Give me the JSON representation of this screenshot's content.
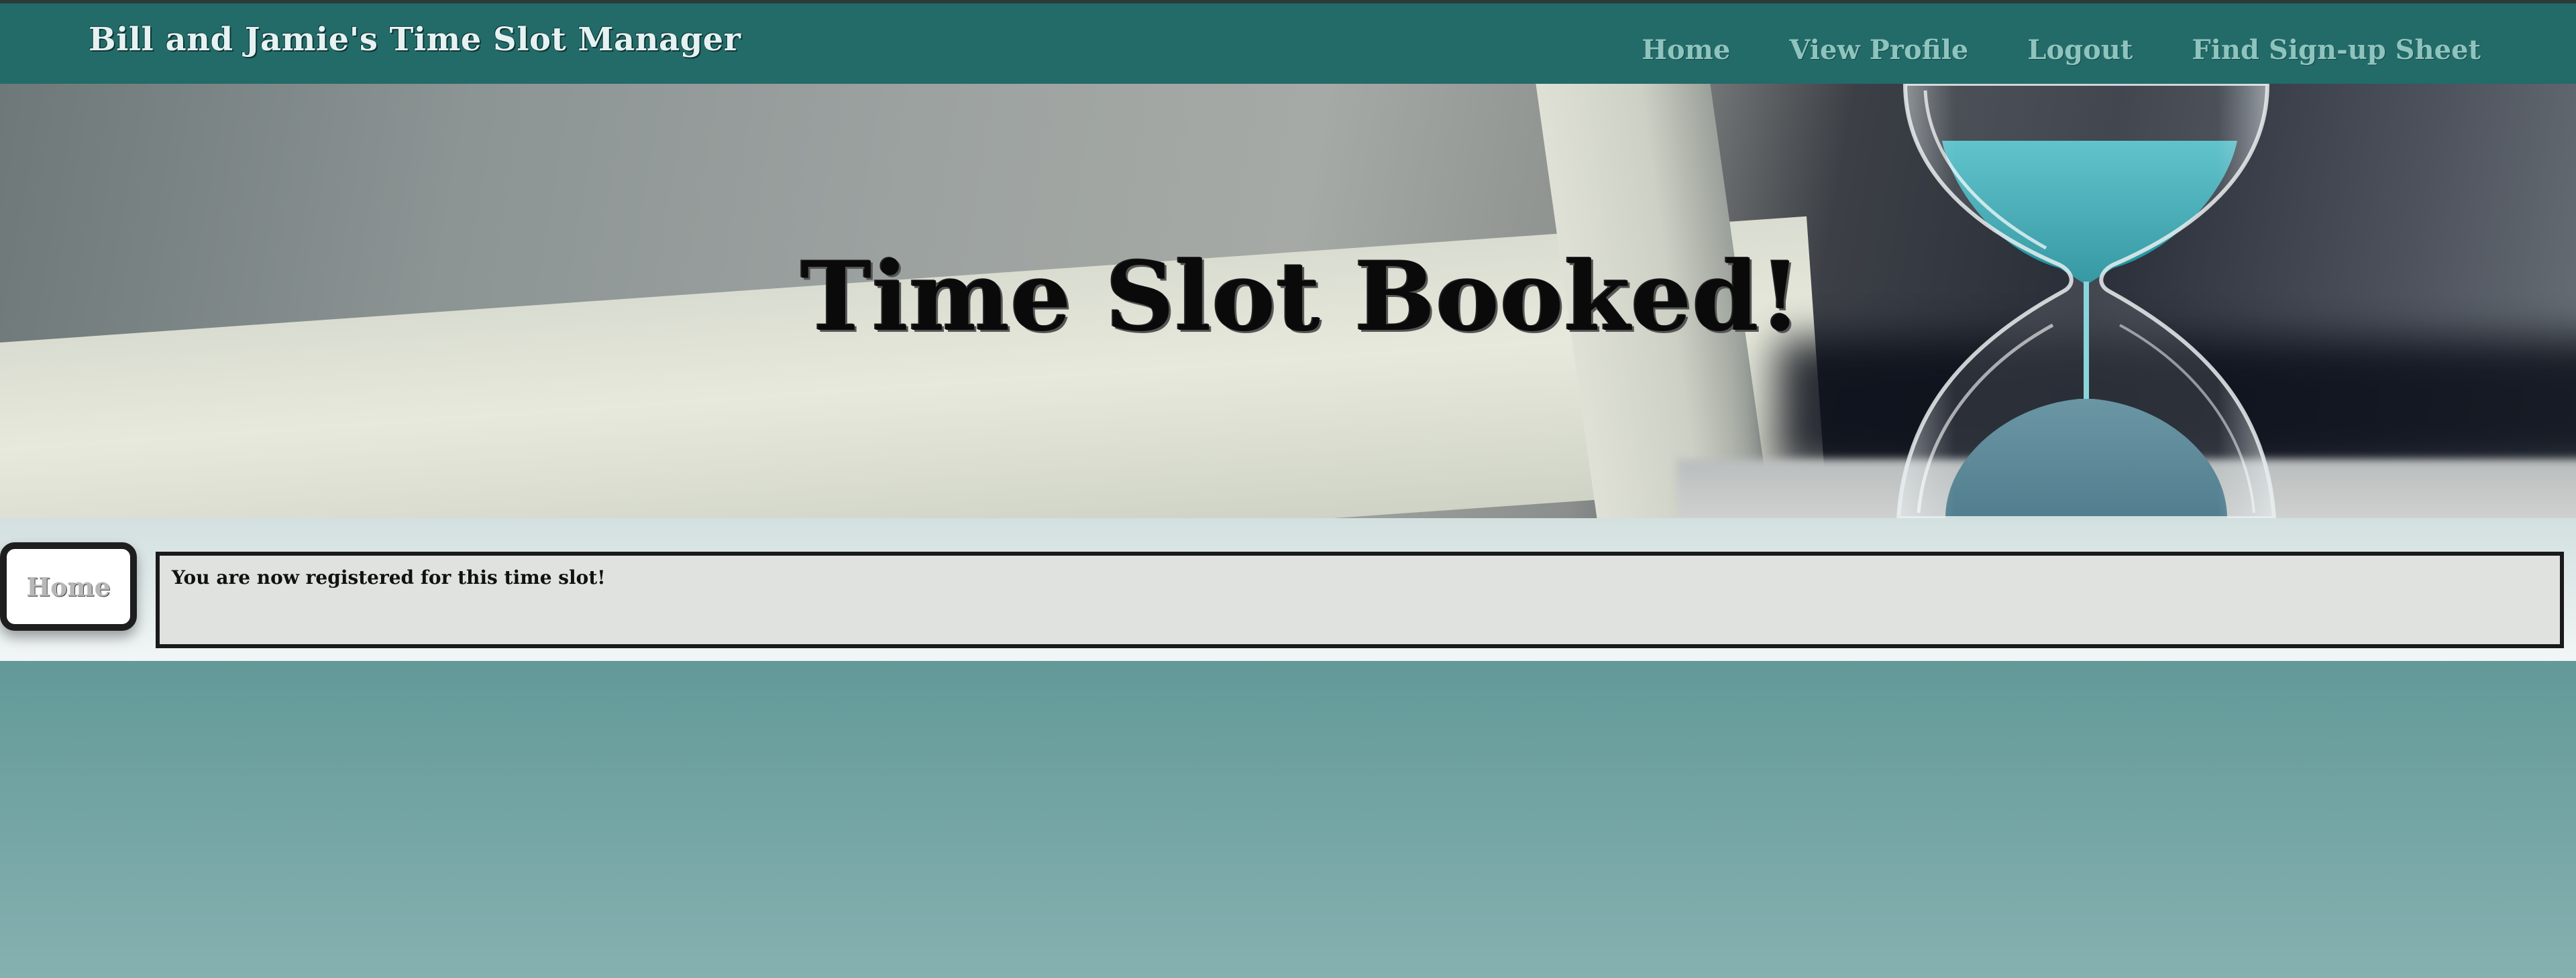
{
  "header": {
    "brand": "Bill and Jamie's Time Slot Manager",
    "nav": [
      {
        "label": "Home"
      },
      {
        "label": "View Profile"
      },
      {
        "label": "Logout"
      },
      {
        "label": "Find Sign-up Sheet"
      }
    ]
  },
  "hero": {
    "title": "Time Slot Booked!",
    "image": "hourglass-image"
  },
  "sidebar": {
    "home_label": "Home"
  },
  "message": {
    "text": "You are now registered for this time slot!"
  },
  "colors": {
    "navbar": "#226b69",
    "brand_text": "#e6f2f2",
    "nav_link": "#8fc3bd",
    "sand_teal": "#2aa3ad",
    "page_bg_top": "#2a6e6d",
    "page_bg_bottom": "#86b1b0"
  }
}
